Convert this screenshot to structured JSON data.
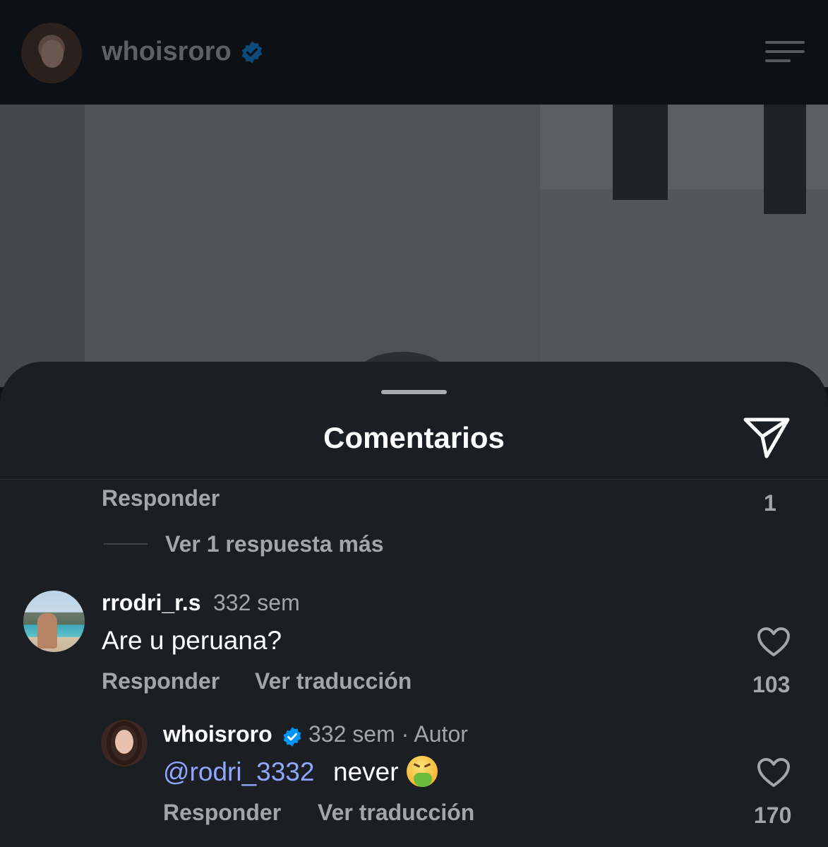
{
  "header": {
    "username": "whoisroro",
    "verified": true,
    "avatar_icon": "profile-avatar",
    "menu_icon": "hamburger-menu-icon"
  },
  "sheet": {
    "title": "Comentarios",
    "share_icon": "send-icon"
  },
  "previous_thread": {
    "reply_label": "Responder",
    "like_count": "1",
    "more_replies_label": "Ver 1 respuesta más"
  },
  "comments": [
    {
      "username": "rrodri_r.s",
      "time": "332 sem",
      "text": "Are u peruana?",
      "reply_label": "Responder",
      "translate_label": "Ver traducción",
      "like_count": "103"
    },
    {
      "username": "whoisroro",
      "verified": true,
      "time": "332 sem · Autor",
      "mention": "@rodri_3332",
      "text": "never",
      "emoji": "vomiting-face-emoji",
      "reply_label": "Responder",
      "translate_label": "Ver traducción",
      "like_count": "170"
    }
  ],
  "colors": {
    "sheet_background": "#1b1e23",
    "mention": "#91a6ff",
    "secondary_text": "#a1a6ad",
    "verified": "#0095f6"
  }
}
